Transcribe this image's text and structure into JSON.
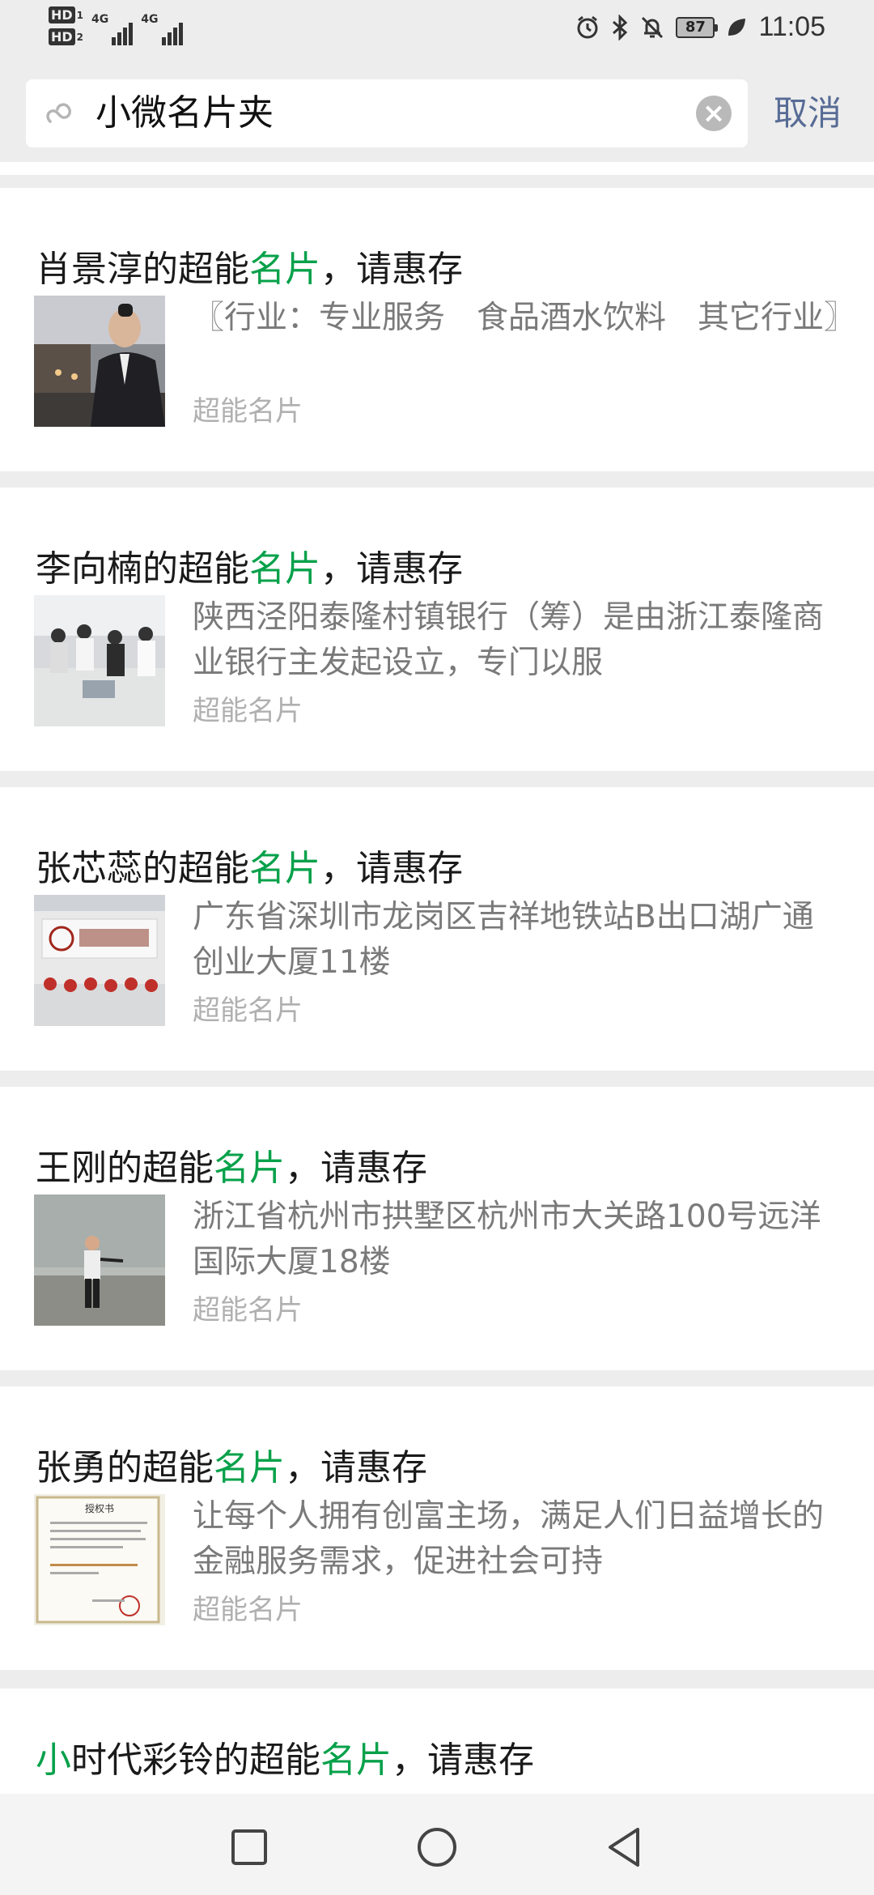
{
  "status_bar": {
    "hd1": "HD",
    "hd1_sub": "1",
    "hd2": "HD",
    "hd2_sub": "2",
    "sim1": "4G",
    "sim2": "4G",
    "battery": "87",
    "time": "11:05",
    "icons": [
      "alarm-icon",
      "bluetooth-icon",
      "mute-icon",
      "battery-icon",
      "leaf-icon"
    ]
  },
  "search": {
    "query": "小微名片夹",
    "cancel_label": "取消"
  },
  "results": [
    {
      "title_prefix": "肖景淳的超能",
      "title_highlight": "名片",
      "title_suffix": "，请惠存",
      "description": "〖行业：专业服务　食品酒水饮料　其它行业〗",
      "source": "超能名片"
    },
    {
      "title_prefix": "李向楠的超能",
      "title_highlight": "名片",
      "title_suffix": "，请惠存",
      "description": "陕西泾阳泰隆村镇银行（筹）是由浙江泰隆商业银行主发起设立，专门以服",
      "source": "超能名片"
    },
    {
      "title_prefix": "张芯蕊的超能",
      "title_highlight": "名片",
      "title_suffix": "，请惠存",
      "description": "广东省深圳市龙岗区吉祥地铁站B出口湖广通创业大厦11楼",
      "source": "超能名片"
    },
    {
      "title_prefix": "王刚的超能",
      "title_highlight": "名片",
      "title_suffix": "，请惠存",
      "description": "浙江省杭州市拱墅区杭州市大关路100号远洋国际大厦18楼",
      "source": "超能名片"
    },
    {
      "title_prefix": "张勇的超能",
      "title_highlight": "名片",
      "title_suffix": "，请惠存",
      "description": "让每个人拥有创富主场，满足人们日益增长的金融服务需求，促进社会可持",
      "source": "超能名片"
    }
  ],
  "partial_result": {
    "title_highlight": "小",
    "title_middle": "时代彩铃的超能",
    "title_highlight2": "名片",
    "title_suffix": "，请惠存"
  },
  "thumb_seal_text": "授权书",
  "colors": {
    "highlight": "#07a14a",
    "link": "#576b95",
    "background": "#ededed"
  }
}
